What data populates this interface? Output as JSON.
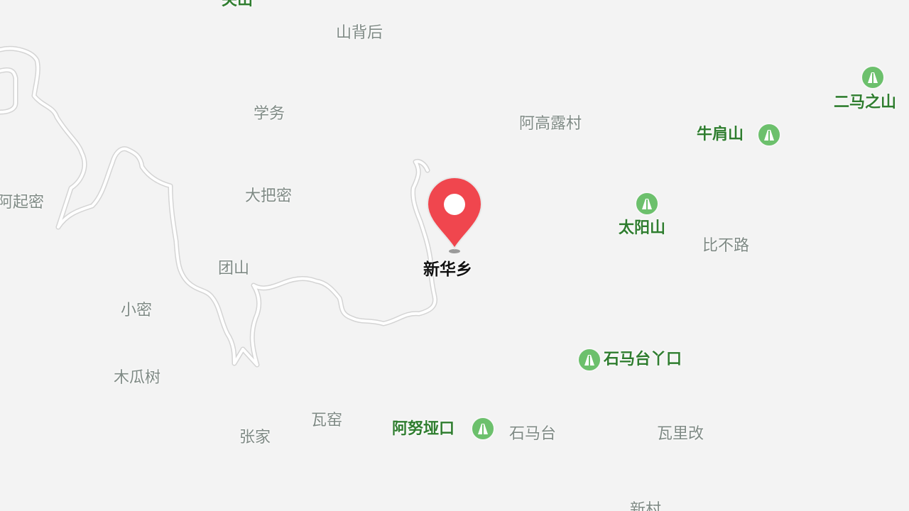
{
  "map": {
    "colors": {
      "background": "#f3f3f3",
      "road": "#ffffff",
      "road_edge": "#d6d6d6",
      "village_text": "#7f8a85",
      "peak_text": "#2f7d2f",
      "peak_icon": "#6cc06c",
      "pin": "#f0464e"
    },
    "villages": {
      "top_partial": "关山",
      "shanbeihou": "山背后",
      "xuewu": "学务",
      "agaolu": "阿高露村",
      "dabami": "大把密",
      "aqimi": "阿起密",
      "tuanshan": "团山",
      "biburu": "比不路",
      "xiaomi": "小密",
      "muguashu": "木瓜树",
      "wayao": "瓦窑",
      "zhangjia": "张家",
      "shimatai": "石马台",
      "waligai": "瓦里改",
      "xincun": "新村"
    },
    "peaks": {
      "ermazhishan": "二马之山",
      "niujianshan": "牛肩山",
      "taiyangshan": "太阳山",
      "shimataiyakou": "石马台丫口",
      "anuyakou": "阿努垭口"
    },
    "marker": {
      "label": "新华乡",
      "icon": "location-pin-icon"
    }
  }
}
